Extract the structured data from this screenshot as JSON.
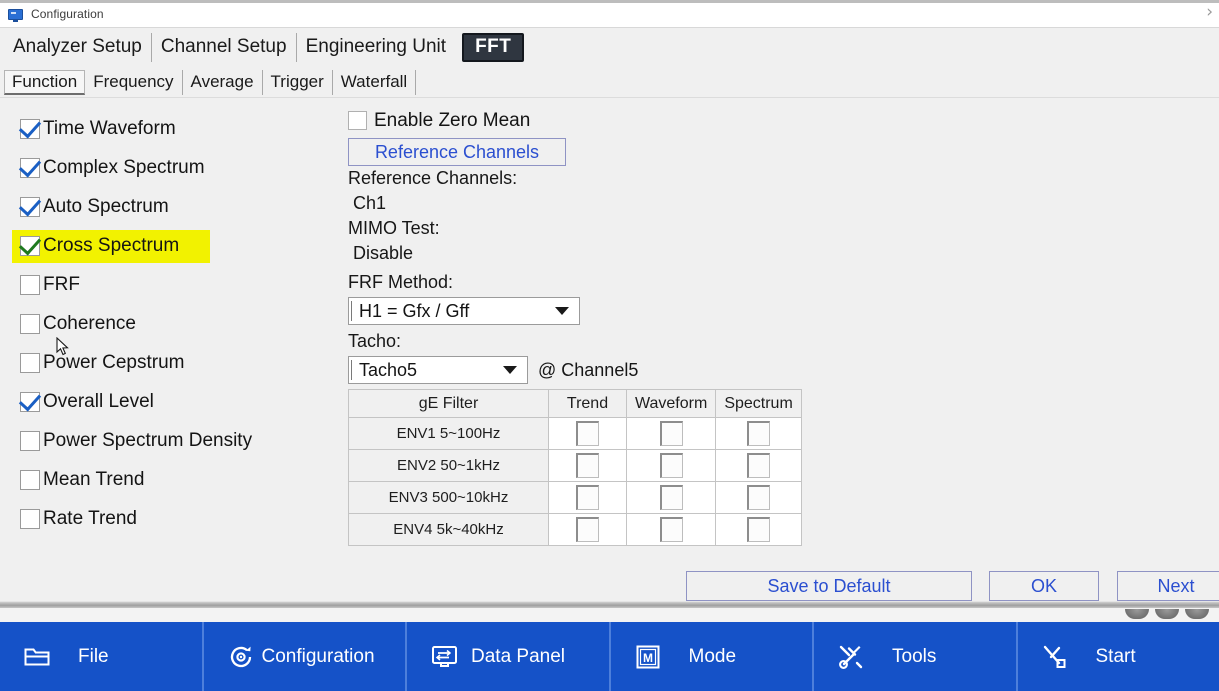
{
  "window": {
    "title": "Configuration",
    "title_icon": "monitor-icon",
    "expand_chevron": "›"
  },
  "main_tabs": [
    {
      "label": "Analyzer Setup",
      "selected": false
    },
    {
      "label": "Channel Setup",
      "selected": false
    },
    {
      "label": "Engineering Unit",
      "selected": false
    },
    {
      "label": "FFT",
      "selected": true
    }
  ],
  "sub_tabs": [
    {
      "label": "Function",
      "selected": true
    },
    {
      "label": "Frequency",
      "selected": false
    },
    {
      "label": "Average",
      "selected": false
    },
    {
      "label": "Trigger",
      "selected": false
    },
    {
      "label": "Waterfall",
      "selected": false
    }
  ],
  "function_checkboxes": [
    {
      "label": "Time Waveform",
      "checked": true,
      "highlighted": false
    },
    {
      "label": "Complex Spectrum",
      "checked": true,
      "highlighted": false
    },
    {
      "label": "Auto Spectrum",
      "checked": true,
      "highlighted": false
    },
    {
      "label": "Cross Spectrum",
      "checked": true,
      "highlighted": true
    },
    {
      "label": "FRF",
      "checked": false,
      "highlighted": false
    },
    {
      "label": "Coherence",
      "checked": false,
      "highlighted": false
    },
    {
      "label": "Power Cepstrum",
      "checked": false,
      "highlighted": false
    },
    {
      "label": "Overall Level",
      "checked": true,
      "highlighted": false
    },
    {
      "label": "Power Spectrum Density",
      "checked": false,
      "highlighted": false
    },
    {
      "label": "Mean Trend",
      "checked": false,
      "highlighted": false
    },
    {
      "label": "Rate Trend",
      "checked": false,
      "highlighted": false
    }
  ],
  "right_panel": {
    "zero_mean_label": "Enable Zero Mean",
    "zero_mean_checked": false,
    "reference_channels_button": "Reference Channels",
    "reference_channels_caption": "Reference Channels:",
    "reference_channels_value": "Ch1",
    "mimo_caption": "MIMO Test:",
    "mimo_value": "Disable",
    "frf_method_label": "FRF Method:",
    "frf_method_value": "H1 = Gfx / Gff",
    "tacho_label": "Tacho:",
    "tacho_value": "Tacho5",
    "tacho_channel": "@ Channel5"
  },
  "ge_table": {
    "headers": [
      "gE Filter",
      "Trend",
      "Waveform",
      "Spectrum"
    ],
    "rows": [
      {
        "name": "ENV1 5~100Hz",
        "trend": false,
        "waveform": false,
        "spectrum": false
      },
      {
        "name": "ENV2 50~1kHz",
        "trend": false,
        "waveform": false,
        "spectrum": false
      },
      {
        "name": "ENV3 500~10kHz",
        "trend": false,
        "waveform": false,
        "spectrum": false
      },
      {
        "name": "ENV4 5k~40kHz",
        "trend": false,
        "waveform": false,
        "spectrum": false
      }
    ]
  },
  "footer_buttons": {
    "save_to_default": "Save to Default",
    "ok": "OK",
    "next": "Next"
  },
  "taskbar": [
    {
      "label": "File",
      "icon": "folder-icon"
    },
    {
      "label": "Configuration",
      "icon": "gear-refresh-icon"
    },
    {
      "label": "Data Panel",
      "icon": "monitor-panel-icon"
    },
    {
      "label": "Mode",
      "icon": "m-box-icon"
    },
    {
      "label": "Tools",
      "icon": "wrench-screwdriver-icon"
    },
    {
      "label": "Start",
      "icon": "scissors-start-icon"
    }
  ],
  "colors": {
    "taskbar_blue": "#1552c8",
    "highlight_yellow": "#f2f200",
    "link_blue": "#2b4fd0",
    "check_blue": "#1a5fc4",
    "selected_tab_bg": "#2f3640",
    "panel_bg": "#f0f0f0"
  }
}
